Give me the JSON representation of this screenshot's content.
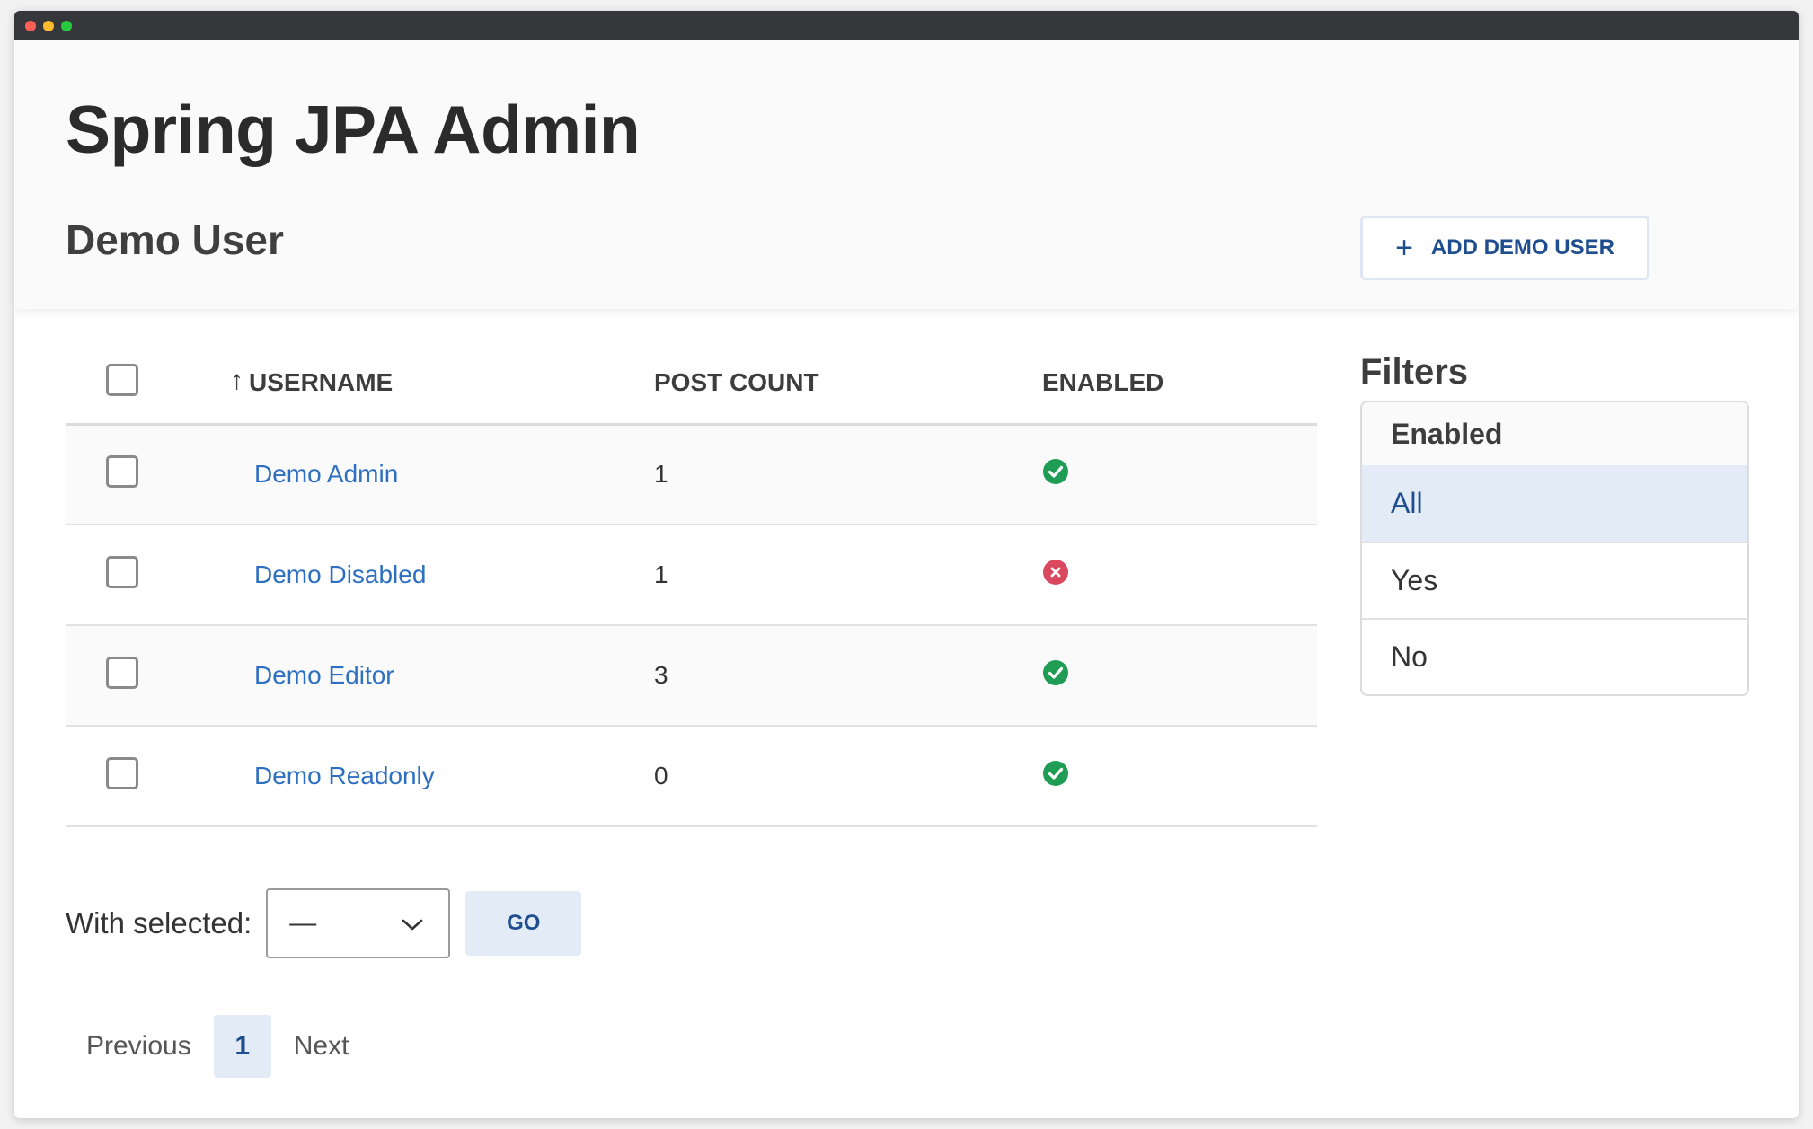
{
  "header": {
    "app_title": "Spring JPA Admin",
    "page_title": "Demo User",
    "add_button_label": "ADD DEMO USER",
    "add_button_icon": "plus-icon"
  },
  "table": {
    "columns": {
      "username": "USERNAME",
      "post_count": "POST COUNT",
      "enabled": "ENABLED"
    },
    "sort": {
      "column": "username",
      "direction": "ascending",
      "icon": "arrow-up-icon"
    },
    "rows": [
      {
        "username": "Demo Admin",
        "post_count": "1",
        "enabled": true
      },
      {
        "username": "Demo Disabled",
        "post_count": "1",
        "enabled": false
      },
      {
        "username": "Demo Editor",
        "post_count": "3",
        "enabled": true
      },
      {
        "username": "Demo Readonly",
        "post_count": "0",
        "enabled": true
      }
    ]
  },
  "bulk_actions": {
    "label": "With selected:",
    "selected_value": "—",
    "go_label": "GO"
  },
  "pagination": {
    "previous_label": "Previous",
    "current_page": "1",
    "next_label": "Next"
  },
  "filters": {
    "title": "Filters",
    "group_title": "Enabled",
    "options": [
      "All",
      "Yes",
      "No"
    ],
    "active_option": "All"
  },
  "colors": {
    "link": "#2d6fc1",
    "accent": "#1f4e8f",
    "accent_bg": "#e3ebf6",
    "enabled_true": "#1f9d55",
    "enabled_false": "#d9485f"
  }
}
